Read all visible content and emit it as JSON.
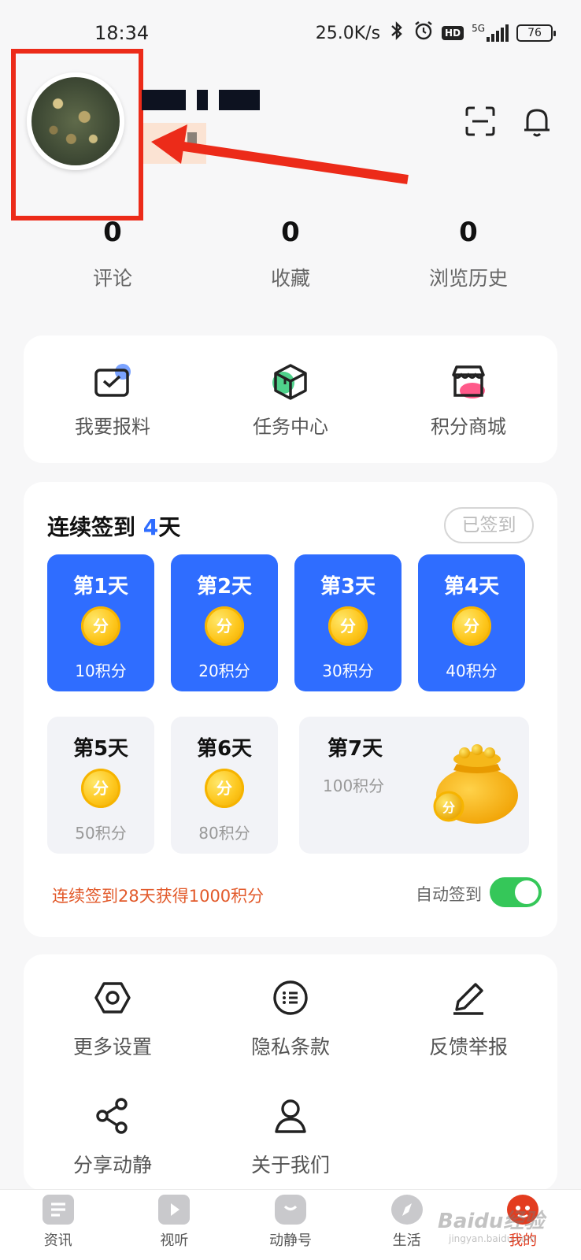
{
  "status_bar": {
    "time": "18:34",
    "speed": "25.0K/s",
    "network": "5G",
    "battery": "76"
  },
  "profile": {
    "scan_icon": "scan-icon",
    "bell_icon": "bell-icon"
  },
  "stats": [
    {
      "value": "0",
      "label": "评论"
    },
    {
      "value": "0",
      "label": "收藏"
    },
    {
      "value": "0",
      "label": "浏览历史"
    }
  ],
  "quick_actions": [
    {
      "label": "我要报料",
      "icon": "mail-check-icon",
      "accent": "#7aa2ff"
    },
    {
      "label": "任务中心",
      "icon": "box-icon",
      "accent": "#4fd18b"
    },
    {
      "label": "积分商城",
      "icon": "shop-icon",
      "accent": "#ff5a8a"
    }
  ],
  "signin": {
    "title_prefix": "连续签到",
    "days_count": "4",
    "title_suffix": "天",
    "button": "已签到",
    "coin_text": "分",
    "days": [
      {
        "name": "第1天",
        "points": "10积分",
        "done": true
      },
      {
        "name": "第2天",
        "points": "20积分",
        "done": true
      },
      {
        "name": "第3天",
        "points": "30积分",
        "done": true
      },
      {
        "name": "第4天",
        "points": "40积分",
        "done": true
      },
      {
        "name": "第5天",
        "points": "50积分",
        "done": false
      },
      {
        "name": "第6天",
        "points": "80积分",
        "done": false
      }
    ],
    "day7": {
      "name": "第7天",
      "points": "100积分"
    },
    "note": "连续签到28天获得1000积分",
    "auto_label": "自动签到",
    "auto_on": true
  },
  "settings": [
    {
      "label": "更多设置",
      "icon": "hexagon-nut-icon"
    },
    {
      "label": "隐私条款",
      "icon": "list-circle-icon"
    },
    {
      "label": "反馈举报",
      "icon": "pen-icon"
    },
    {
      "label": "分享动静",
      "icon": "share-icon"
    },
    {
      "label": "关于我们",
      "icon": "user-icon"
    }
  ],
  "bottom_nav": [
    {
      "label": "资讯",
      "icon": "news-icon"
    },
    {
      "label": "视听",
      "icon": "play-icon"
    },
    {
      "label": "动静号",
      "icon": "chat-icon"
    },
    {
      "label": "生活",
      "icon": "compass-icon"
    },
    {
      "label": "我的",
      "icon": "mascot-icon",
      "active": true
    }
  ],
  "watermark": {
    "text": "Baidu经验",
    "sub": "jingyan.baidu.com"
  },
  "colors": {
    "accent_blue": "#2f6dff",
    "annotation_red": "#ec2b19",
    "toggle_green": "#35c759",
    "note_orange": "#e25a2b"
  }
}
